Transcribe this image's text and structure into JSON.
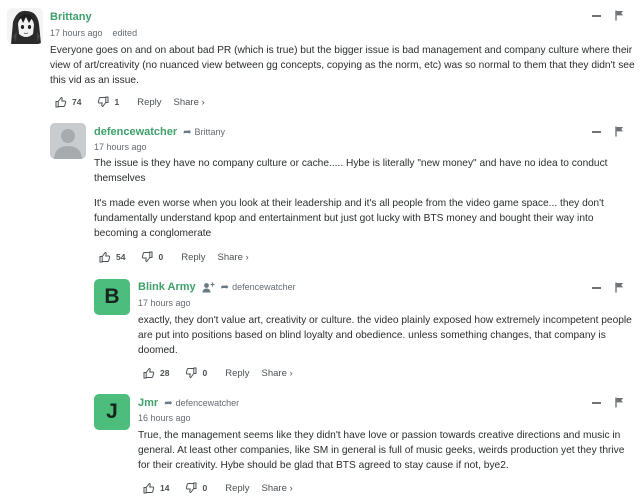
{
  "comments": [
    {
      "username": "Brittany",
      "reply_to": "",
      "time": "17 hours ago",
      "edited": "edited",
      "paragraphs": [
        "Everyone goes on and on about bad PR (which is true) but the bigger issue is bad management and company culture where their view of art/creativity (no nuanced view between gg concepts, copying as the norm, etc) was so normal to them that they didn't see this vid as an issue."
      ],
      "upvotes": "74",
      "downvotes": "1",
      "reply_label": "Reply",
      "share_label": "Share ›",
      "avatar": "anime-portrait"
    },
    {
      "username": "defencewatcher",
      "reply_to": "Brittany",
      "time": "17 hours ago",
      "edited": "",
      "paragraphs": [
        "The issue is they have no company culture or cache..... Hybe is literally \"new money\" and have no idea to conduct themselves",
        "It's made even worse when you look at their leadership and it's all people from the video game space... they don't fundamentally understand kpop and entertainment but just got lucky with BTS money and bought their way into becoming a conglomerate"
      ],
      "upvotes": "54",
      "downvotes": "0",
      "reply_label": "Reply",
      "share_label": "Share ›",
      "avatar": "default-user"
    },
    {
      "username": "Blink Army",
      "reply_to": "defencewatcher",
      "time": "17 hours ago",
      "edited": "",
      "paragraphs": [
        "exactly, they don't value art, creativity or culture. the video plainly exposed how extremely incompetent people are put into positions based on blind loyalty and obedience. unless something changes, that company is doomed."
      ],
      "upvotes": "28",
      "downvotes": "0",
      "reply_label": "Reply",
      "share_label": "Share ›",
      "avatar_letter": "B"
    },
    {
      "username": "Jmr",
      "reply_to": "defencewatcher",
      "time": "16 hours ago",
      "edited": "",
      "paragraphs": [
        "True, the management seems like they didn't have love or passion towards creative directions and music in general. At least other companies, like SM in general is full of music geeks, weirds production yet they thrive for their creativity. Hybe should be glad that BTS agreed to stay cause if not, bye2."
      ],
      "upvotes": "14",
      "downvotes": "0",
      "reply_label": "Reply",
      "share_label": "Share ›",
      "avatar_letter": "J"
    }
  ],
  "colors": {
    "username": "#3ea06a",
    "avatar_green": "#4dbd7b",
    "text": "#2a2e2e",
    "meta": "#656c73"
  }
}
